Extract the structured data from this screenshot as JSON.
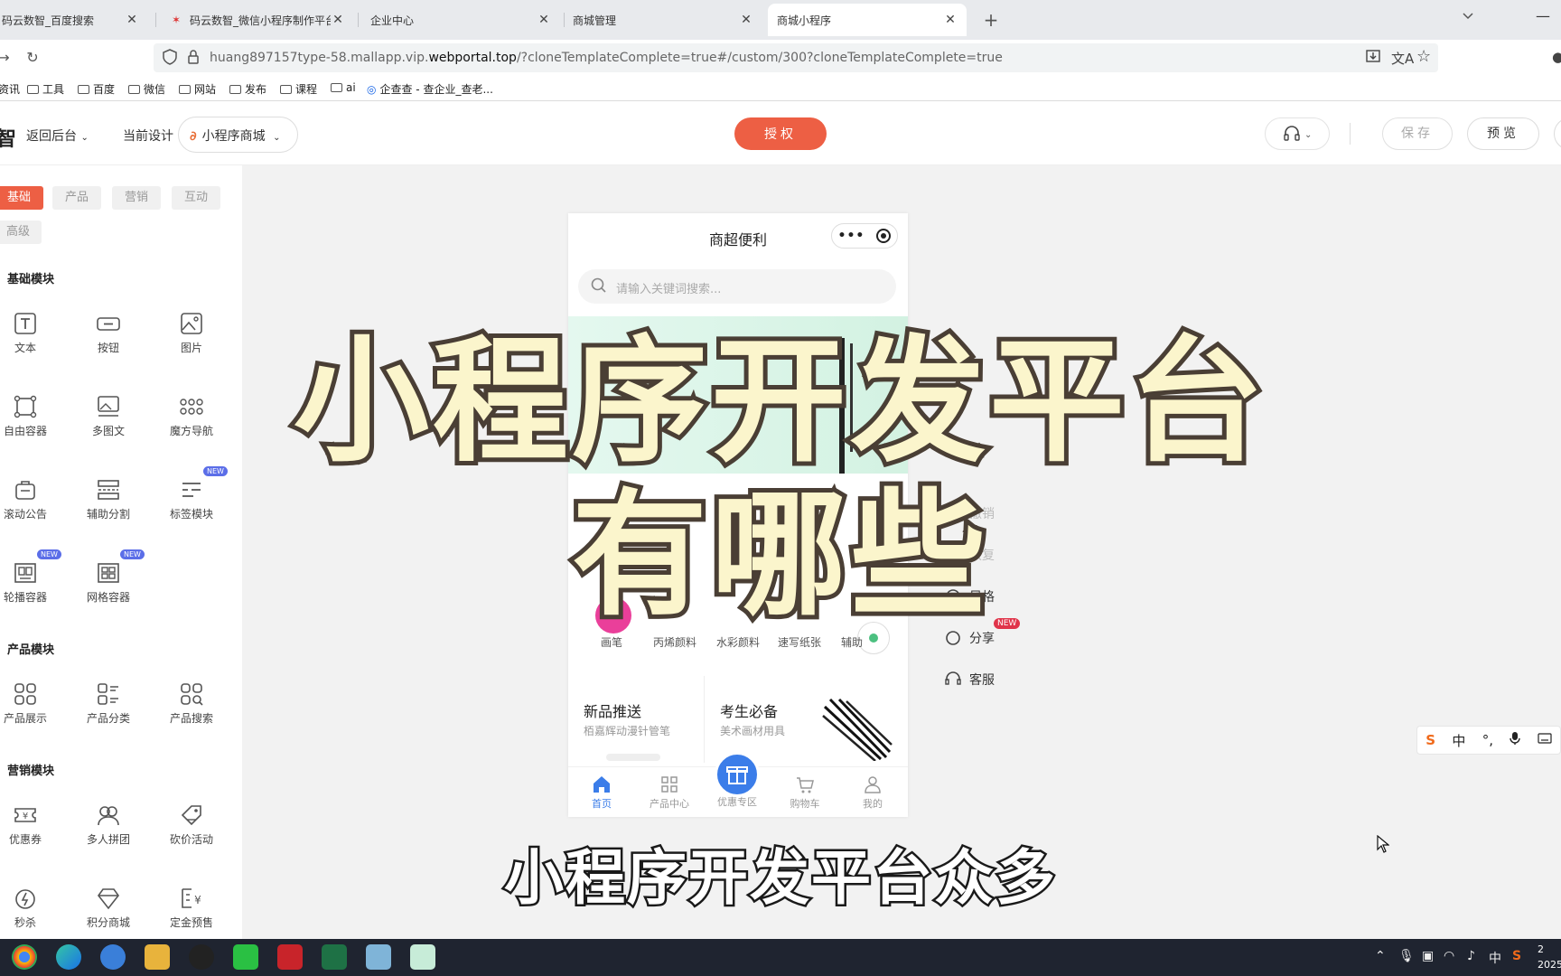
{
  "browser": {
    "tabs": [
      {
        "title": "码云数智_百度搜索",
        "active": false
      },
      {
        "title": "码云数智_微信小程序制作平台_",
        "active": false
      },
      {
        "title": "企业中心",
        "active": false
      },
      {
        "title": "商城管理",
        "active": false
      },
      {
        "title": "商城小程序",
        "active": true
      }
    ],
    "url_prefix": "huang897157type-58.mallapp.vip.",
    "url_domain": "webportal.top",
    "url_suffix": "/?cloneTemplateComplete=true#/custom/300?cloneTemplateComplete=true",
    "bookmarks": [
      "资讯",
      "工具",
      "百度",
      "微信",
      "网站",
      "发布",
      "课程",
      "ai",
      "企查查 - 查企业_查老..."
    ]
  },
  "header": {
    "logo_fragment": "智",
    "back_label": "返回后台",
    "current_design_label": "当前设计",
    "app_select_value": "小程序商城",
    "auth_label": "授权",
    "save_label": "保存",
    "preview_label": "预览"
  },
  "palette": {
    "tabs": [
      "基础",
      "产品",
      "营销",
      "互动",
      "高级"
    ],
    "active_tab": "基础",
    "sections": {
      "basic": {
        "title": "基础模块",
        "items": [
          "文本",
          "按钮",
          "图片",
          "自由容器",
          "多图文",
          "魔方导航",
          "滚动公告",
          "辅助分割",
          "标签模块",
          "轮播容器",
          "网格容器"
        ]
      },
      "product": {
        "title": "产品模块",
        "items": [
          "产品展示",
          "产品分类",
          "产品搜索"
        ]
      },
      "marketing": {
        "title": "营销模块",
        "items": [
          "优惠券",
          "多人拼团",
          "砍价活动",
          "秒杀",
          "积分商城",
          "定金预售"
        ]
      }
    },
    "new_badge": "NEW"
  },
  "phone": {
    "title": "商超便利",
    "search_placeholder": "请输入关键词搜索...",
    "categories": [
      "画笔",
      "丙烯颜料",
      "水彩颜料",
      "速写纸张",
      "辅助"
    ],
    "promo": [
      {
        "title": "新品推送",
        "subtitle": "栢嘉辉动漫针管笔"
      },
      {
        "title": "考生必备",
        "subtitle": "美术画材用具"
      }
    ],
    "tabbar": [
      "首页",
      "产品中心",
      "优惠专区",
      "购物车",
      "我的"
    ],
    "active_tab": "首页"
  },
  "side_menu": {
    "items": [
      "撤销",
      "恢复",
      "风格",
      "分享",
      "客服"
    ],
    "share_badge": "NEW"
  },
  "ime": {
    "lang": "中"
  },
  "overlay": {
    "line1": "小程序开发平台",
    "line2": "有哪些",
    "subtitle": "小程序开发平台众多"
  },
  "taskbar": {
    "tray_lang": "中",
    "clock_time": "2",
    "clock_year": "2025"
  },
  "colors": {
    "accent": "#ed5f44",
    "phone_blue": "#3b7de9",
    "overlay_fill": "#fbf5cc",
    "overlay_stroke": "#4a3f35"
  }
}
